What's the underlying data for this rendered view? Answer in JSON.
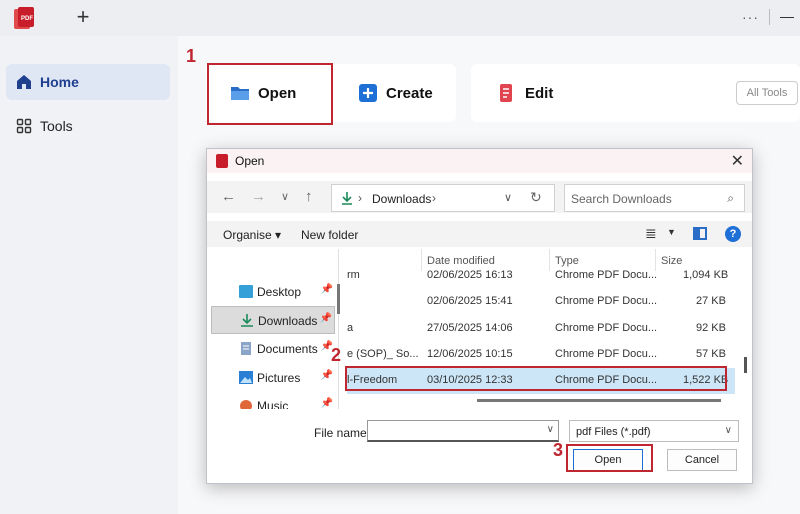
{
  "app": {
    "new_tab_symbol": "+",
    "window_dots": "···"
  },
  "sidebar": {
    "items": [
      {
        "label": "Home",
        "icon": "home-icon",
        "active": true
      },
      {
        "label": "Tools",
        "icon": "grid-icon",
        "active": false
      }
    ]
  },
  "actions": {
    "open_label": "Open",
    "create_label": "Create",
    "edit_label": "Edit",
    "all_tools_label": "All Tools"
  },
  "steps": [
    "1",
    "2",
    "3"
  ],
  "dialog": {
    "title": "Open",
    "close_symbol": "✕",
    "address": {
      "folder": "Downloads",
      "separator": "›"
    },
    "search_placeholder": "Search Downloads",
    "organise_label": "Organise ▾",
    "new_folder_label": "New folder",
    "help_symbol": "?",
    "nav_items": [
      {
        "label": "Desktop",
        "icon": "desktop-icon",
        "selected": false
      },
      {
        "label": "Downloads",
        "icon": "download-icon",
        "selected": true
      },
      {
        "label": "Documents",
        "icon": "documents-icon",
        "selected": false
      },
      {
        "label": "Pictures",
        "icon": "pictures-icon",
        "selected": false
      },
      {
        "label": "Music",
        "icon": "music-icon",
        "selected": false
      }
    ],
    "columns": {
      "date": "Date modified",
      "type": "Type",
      "size": "Size"
    },
    "files": [
      {
        "name": "rm",
        "date": "02/06/2025 16:13",
        "type": "Chrome PDF Docu...",
        "size": "1,094 KB",
        "selected": false
      },
      {
        "name": "",
        "date": "02/06/2025 15:41",
        "type": "Chrome PDF Docu...",
        "size": "27 KB",
        "selected": false
      },
      {
        "name": "a",
        "date": "27/05/2025 14:06",
        "type": "Chrome PDF Docu...",
        "size": "92 KB",
        "selected": false
      },
      {
        "name": "e (SOP)_ So...",
        "date": "12/06/2025 10:15",
        "type": "Chrome PDF Docu...",
        "size": "57 KB",
        "selected": false
      },
      {
        "name": "l-Freedom",
        "date": "03/10/2025 12:33",
        "type": "Chrome PDF Docu...",
        "size": "1,522 KB",
        "selected": true
      }
    ],
    "file_name_label": "File name:",
    "file_name_value": "",
    "file_type": "pdf Files (*.pdf)",
    "open_button": "Open",
    "cancel_button": "Cancel"
  },
  "colors": {
    "highlight": "#c0262f",
    "accent": "#1e6fd6",
    "selection": "#cde6f7"
  }
}
